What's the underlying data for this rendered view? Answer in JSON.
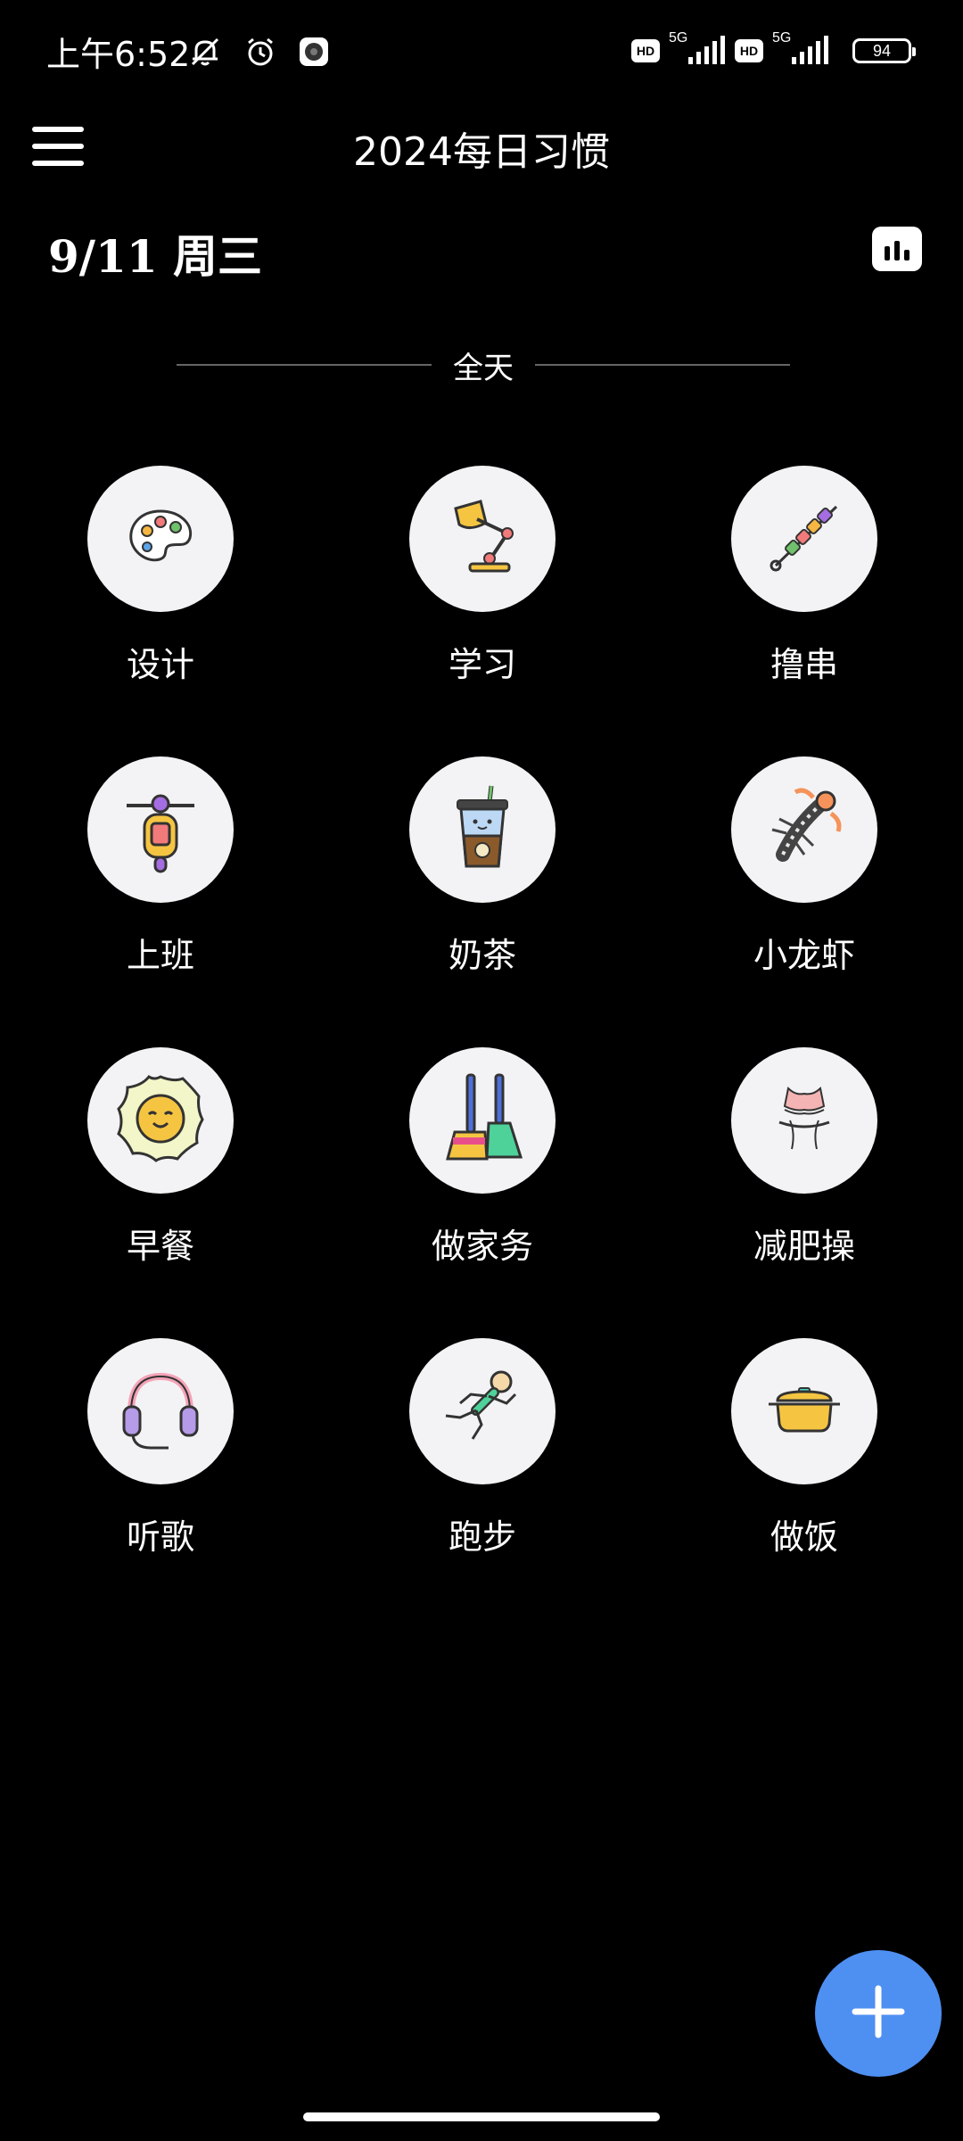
{
  "status_bar": {
    "time": "上午6:52",
    "hd_label": "HD",
    "network_label": "5G",
    "battery_level": "94"
  },
  "app_bar": {
    "title": "2024每日习惯"
  },
  "date": {
    "label": "9/11 周三"
  },
  "section": {
    "label": "全天"
  },
  "habits": [
    {
      "label": "设计",
      "icon": "palette-icon"
    },
    {
      "label": "学习",
      "icon": "desk-lamp-icon"
    },
    {
      "label": "撸串",
      "icon": "skewer-icon"
    },
    {
      "label": "上班",
      "icon": "scooter-icon"
    },
    {
      "label": "奶茶",
      "icon": "milk-tea-icon"
    },
    {
      "label": "小龙虾",
      "icon": "crayfish-icon"
    },
    {
      "label": "早餐",
      "icon": "fried-egg-icon"
    },
    {
      "label": "做家务",
      "icon": "brooms-icon"
    },
    {
      "label": "减肥操",
      "icon": "slim-waist-icon"
    },
    {
      "label": "听歌",
      "icon": "headphones-icon"
    },
    {
      "label": "跑步",
      "icon": "runner-icon"
    },
    {
      "label": "做饭",
      "icon": "cooking-pot-icon"
    }
  ],
  "colors": {
    "background": "#000000",
    "circle": "#f3f3f5",
    "fab": "#4e8ff2"
  }
}
